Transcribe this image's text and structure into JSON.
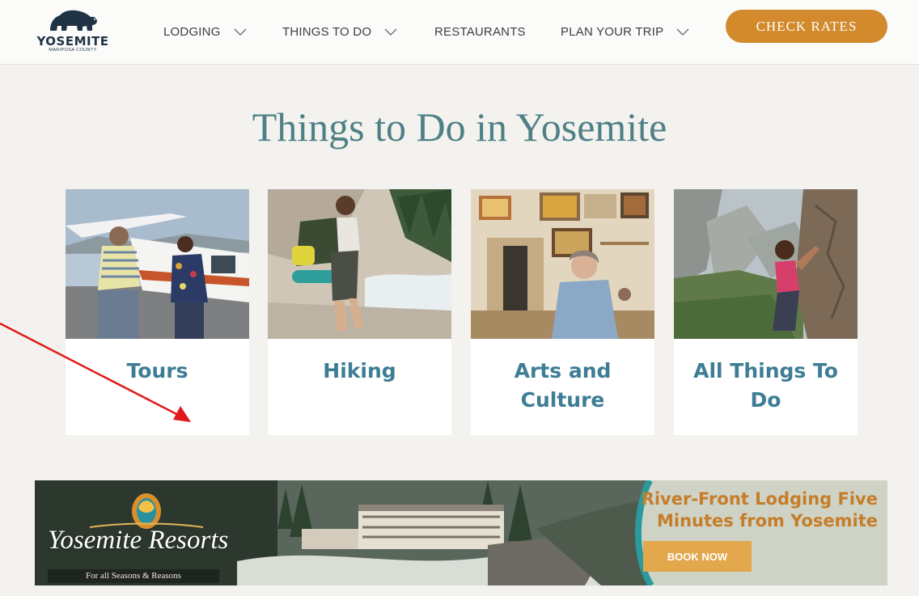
{
  "header": {
    "logo": {
      "wordmark": "YOSEMITE",
      "subline": "MARIPOSA COUNTY"
    },
    "nav": [
      {
        "label": "LODGING",
        "has_dropdown": true
      },
      {
        "label": "THINGS TO DO",
        "has_dropdown": true
      },
      {
        "label": "RESTAURANTS",
        "has_dropdown": false
      },
      {
        "label": "PLAN YOUR TRIP",
        "has_dropdown": true
      }
    ],
    "cta_label": "CHECK RATES"
  },
  "main": {
    "title": "Things to Do in Yosemite",
    "cards": [
      {
        "label": "Tours",
        "image": "tour-plane-photo"
      },
      {
        "label": "Hiking",
        "image": "hiker-waterfall-photo"
      },
      {
        "label": "Arts and Culture",
        "image": "artist-studio-photo"
      },
      {
        "label": "All Things To Do",
        "image": "rock-climber-photo"
      }
    ]
  },
  "banner": {
    "brand": "Yosemite Resorts",
    "tagline": "For all Seasons & Reasons",
    "headline": "River-Front Lodging Five Minutes from Yosemite",
    "button": "BOOK NOW"
  },
  "colors": {
    "accent_orange": "#d28a2c",
    "title_teal": "#4e8085",
    "card_label_blue": "#3d7d95",
    "annotation_arrow": "#e0191b"
  }
}
